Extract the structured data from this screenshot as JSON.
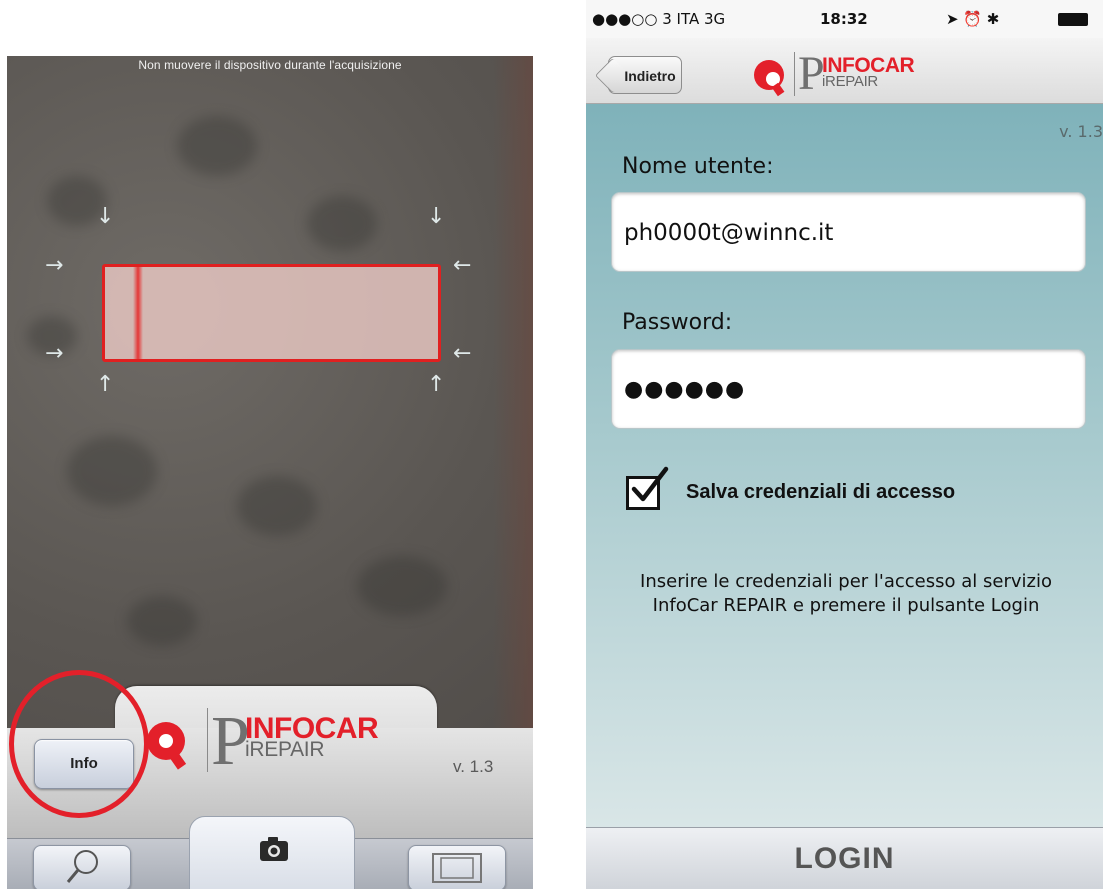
{
  "left": {
    "hint": "Non muovere il dispositivo durante l'acquisizione",
    "info_button": "Info",
    "logo": {
      "brand": "INFOCAR",
      "sub": "iREPAIR"
    },
    "version": "v. 1.3",
    "toolbar": {
      "search_icon": "search-icon",
      "camera_icon": "camera-icon",
      "frame_icon": "frame-icon"
    },
    "highlight_color": "#e3202a"
  },
  "right": {
    "status": {
      "carrier": "●●●○○ 3 ITA  3G",
      "time": "18:32",
      "icons": "➤ ⏰ ✱"
    },
    "nav": {
      "back_label": "Indietro",
      "logo": {
        "brand": "INFOCAR",
        "sub": "iREPAIR"
      }
    },
    "version": "v. 1.3",
    "username_label": "Nome utente:",
    "username_value": "ph0000t@winnc.it",
    "password_label": "Password:",
    "password_value": "●●●●●●",
    "save_checked": true,
    "save_label": "Salva credenziali di accesso",
    "help_text": "Inserire le credenziali per l'accesso al servizio InfoCar REPAIR e premere il pulsante Login",
    "login_button": "LOGIN"
  }
}
